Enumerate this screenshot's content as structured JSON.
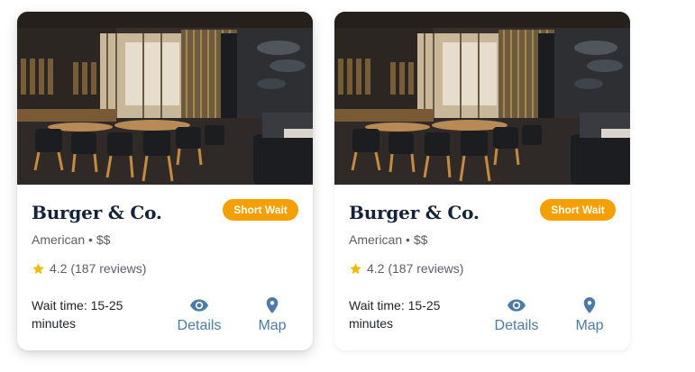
{
  "cards": [
    {
      "image_alt": "restaurant dining room",
      "name": "Burger & Co.",
      "badge": "Short Wait",
      "cuisine": "American",
      "price": "$$",
      "separator": "•",
      "rating": "4.2",
      "reviews": "(187 reviews)",
      "wait_label": "Wait time:",
      "wait_value": "15-25 minutes",
      "details_label": "Details",
      "map_label": "Map"
    },
    {
      "image_alt": "restaurant dining room",
      "name": "Burger & Co.",
      "badge": "Short Wait",
      "cuisine": "American",
      "price": "$$",
      "separator": "•",
      "rating": "4.2",
      "reviews": "(187 reviews)",
      "wait_label": "Wait time:",
      "wait_value": "15-25 minutes",
      "details_label": "Details",
      "map_label": "Map"
    }
  ],
  "colors": {
    "badge": "#f5a000",
    "accent": "#4a7bac",
    "star": "#f5b800",
    "title": "#14233a"
  },
  "icons": {
    "rating": "star-icon",
    "details": "eye-icon",
    "map": "map-pin-icon"
  }
}
